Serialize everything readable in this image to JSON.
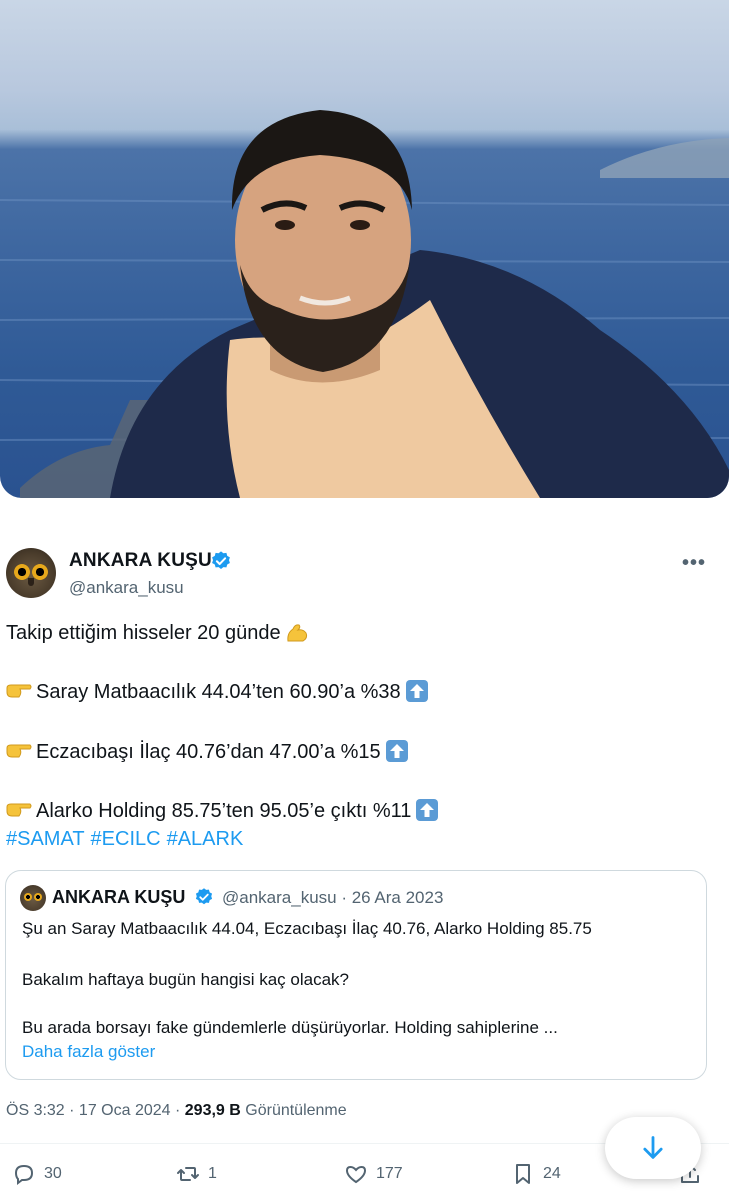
{
  "photo": {
    "alt_icon": "profile-photo"
  },
  "tweet": {
    "author_name": "ANKARA KUŞU",
    "author_handle": "@ankara_kusu",
    "more_label": "•••",
    "lines": [
      "Takip ettiğim hisseler 20 günde",
      "Saray Matbaacılık 44.04’ten 60.90’a %38",
      "Eczacıbaşı İlaç 40.76’dan 47.00’a %15",
      "Alarko Holding 85.75’ten 95.05’e çıktı %11"
    ],
    "hashtags": [
      "#SAMAT",
      "#ECILC",
      "#ALARK"
    ],
    "icons": {
      "line1_emoji": "flexed-biceps-icon",
      "bullet": "pointing-right-icon",
      "trend": "up-arrow-icon"
    }
  },
  "quote": {
    "author_name": "ANKARA KUŞU",
    "meta": "@ankara_kusu · 26 Ara 2023",
    "lines": [
      "Şu an Saray Matbaacılık 44.04, Eczacıbaşı İlaç 40.76, Alarko Holding 85.75",
      "Bakalım haftaya bugün hangisi kaç olacak?",
      "Bu arada borsayı fake gündemlerle düşürüyorlar. Holding sahiplerine ..."
    ],
    "show_more": "Daha fazla göster"
  },
  "footer": {
    "time": "ÖS 3:32 · 17 Oca 2024 · ",
    "views": "293,9 B",
    "views_label": "Görüntülenme"
  },
  "actions": {
    "replies": "30",
    "retweets": "1",
    "likes": "177",
    "bookmarks": "24"
  },
  "colors": {
    "accent": "#1d9bf0",
    "muted": "#536471",
    "text": "#0f1419",
    "border": "#cfd9de"
  }
}
